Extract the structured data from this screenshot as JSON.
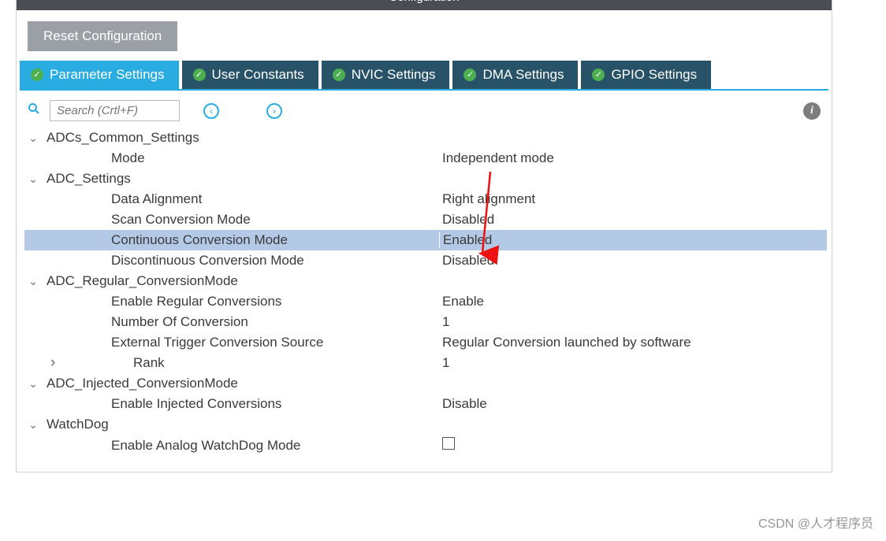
{
  "titlebar": "Configuration",
  "reset_button": "Reset Configuration",
  "tabs": [
    {
      "label": "Parameter Settings"
    },
    {
      "label": "User Constants"
    },
    {
      "label": "NVIC Settings"
    },
    {
      "label": "DMA Settings"
    },
    {
      "label": "GPIO Settings"
    }
  ],
  "search": {
    "placeholder": "Search (Crtl+F)"
  },
  "groups": {
    "adcs_common": {
      "header": "ADCs_Common_Settings",
      "mode": {
        "label": "Mode",
        "value": "Independent mode"
      }
    },
    "adc_settings": {
      "header": "ADC_Settings",
      "data_alignment": {
        "label": "Data Alignment",
        "value": "Right alignment"
      },
      "scan": {
        "label": "Scan Conversion Mode",
        "value": "Disabled"
      },
      "continuous": {
        "label": "Continuous Conversion Mode",
        "value": "Enabled"
      },
      "discontinuous": {
        "label": "Discontinuous Conversion Mode",
        "value": "Disabled"
      }
    },
    "adc_regular": {
      "header": "ADC_Regular_ConversionMode",
      "enable_regular": {
        "label": "Enable Regular Conversions",
        "value": "Enable"
      },
      "num_conv": {
        "label": "Number Of Conversion",
        "value": "1"
      },
      "ext_trigger": {
        "label": "External Trigger Conversion Source",
        "value": "Regular Conversion launched by software"
      },
      "rank": {
        "label": "Rank",
        "value": "1"
      }
    },
    "adc_injected": {
      "header": "ADC_Injected_ConversionMode",
      "enable_injected": {
        "label": "Enable Injected Conversions",
        "value": "Disable"
      }
    },
    "watchdog": {
      "header": "WatchDog",
      "enable_analog": {
        "label": "Enable Analog WatchDog Mode"
      }
    }
  },
  "watermark": "CSDN @人才程序员"
}
